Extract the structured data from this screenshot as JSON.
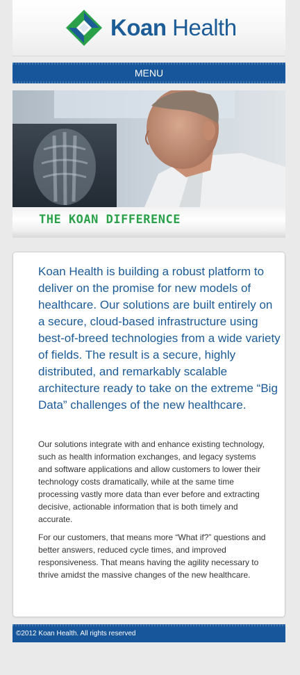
{
  "brand": {
    "name_bold": "Koan",
    "name_light": "Health",
    "logo_icon": "koan-diamond-logo",
    "color_primary": "#1c5c97",
    "color_accent": "#2aa149"
  },
  "nav": {
    "menu_label": "MENU"
  },
  "hero": {
    "caption": "THE KOAN DIFFERENCE"
  },
  "content": {
    "lead": "Koan Health is building a robust platform to deliver on the promise for new models of healthcare. Our solutions are built entirely on a secure, cloud-based infrastructure using best-of-breed technologies from a wide variety of fields. The result is a secure, highly distributed, and remarkably scalable architecture ready to take on the extreme “Big Data” challenges of the new healthcare.",
    "paragraph1": "Our solutions integrate with and enhance existing technology, such as health information exchanges, and legacy systems and software applications and allow customers to lower their technology costs dramatically, while at the same time processing vastly more data than ever before and extracting decisive, actionable information that is both timely and accurate.",
    "paragraph2": "For our customers, that means more “What if?” questions and better answers, reduced cycle times, and improved responsiveness. That means having the agility necessary to thrive amidst the massive changes of the new healthcare."
  },
  "footer": {
    "copyright": "©2012 Koan Health. All rights reserved"
  }
}
